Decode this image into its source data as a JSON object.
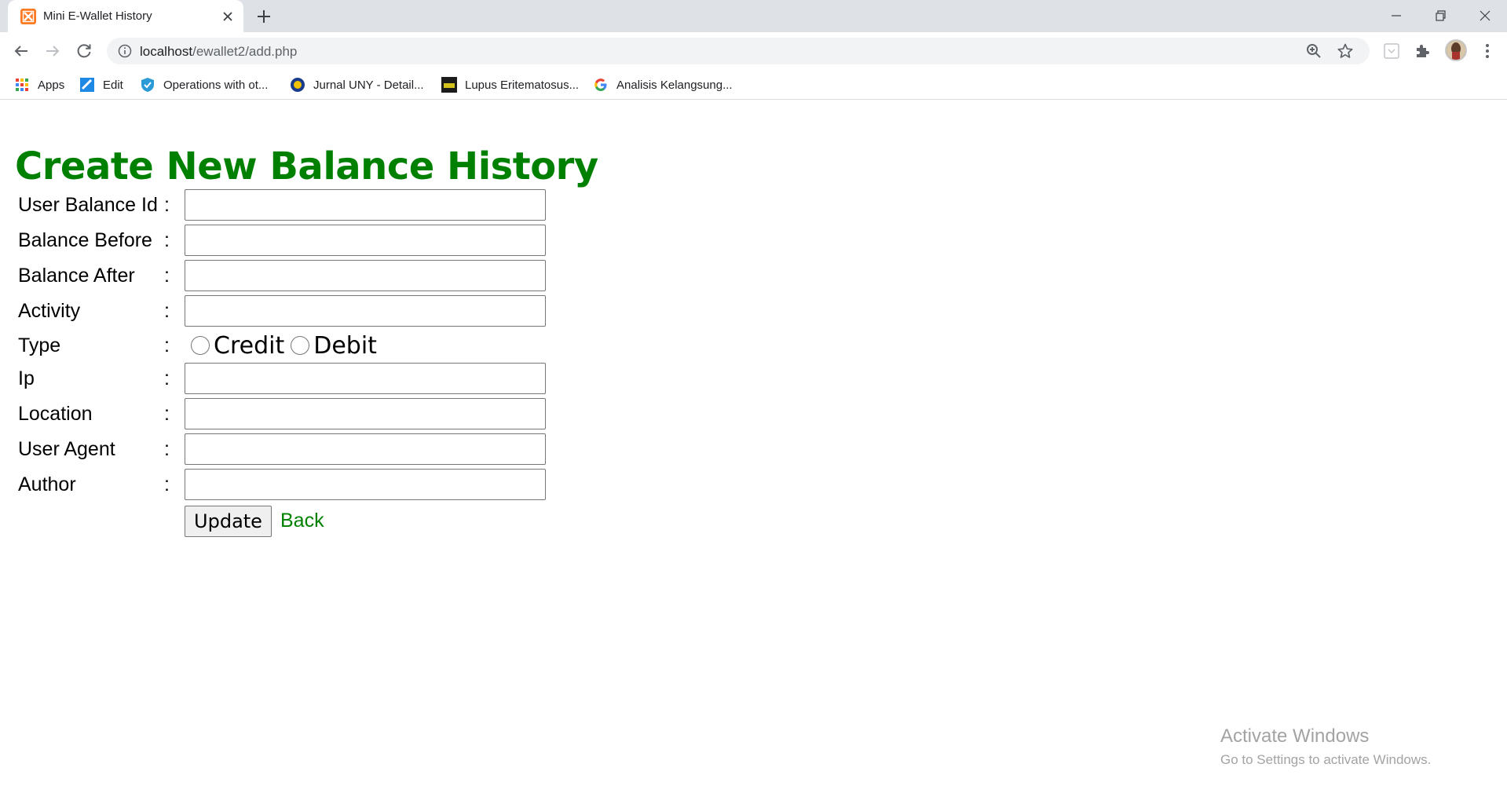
{
  "browser": {
    "tab_title": "Mini E-Wallet History",
    "url_host": "localhost",
    "url_path": "/ewallet2/add.php",
    "bookmarks": [
      {
        "label": "Apps",
        "icon": "apps-grid-icon"
      },
      {
        "label": "Edit",
        "icon": "edit-bookmark-icon"
      },
      {
        "label": "Operations with ot...",
        "icon": "shield-icon"
      },
      {
        "label": "Jurnal UNY - Detail...",
        "icon": "uny-logo-icon"
      },
      {
        "label": "Lupus Eritematosus...",
        "icon": "jka-logo-icon"
      },
      {
        "label": "Analisis Kelangsung...",
        "icon": "google-icon"
      }
    ]
  },
  "form": {
    "heading": "Create New Balance History",
    "fields": [
      {
        "label": "User Balance Id",
        "colon": ":",
        "value": ""
      },
      {
        "label": "Balance Before",
        "colon": ":",
        "value": ""
      },
      {
        "label": "Balance After",
        "colon": ":",
        "value": ""
      },
      {
        "label": "Activity",
        "colon": ":",
        "value": ""
      },
      {
        "label": "Type",
        "colon": ":"
      },
      {
        "label": "Ip",
        "colon": ":",
        "value": ""
      },
      {
        "label": "Location",
        "colon": ":",
        "value": ""
      },
      {
        "label": "User Agent",
        "colon": ":",
        "value": ""
      },
      {
        "label": "Author",
        "colon": ":",
        "value": ""
      }
    ],
    "type_options": [
      "Credit",
      "Debit"
    ],
    "submit_label": "Update",
    "back_label": "Back"
  },
  "watermark": {
    "line1": "Activate Windows",
    "line2": "Go to Settings to activate Windows."
  },
  "colors": {
    "heading": "#008000",
    "link": "#008000",
    "tabstrip": "#dee1e6"
  }
}
